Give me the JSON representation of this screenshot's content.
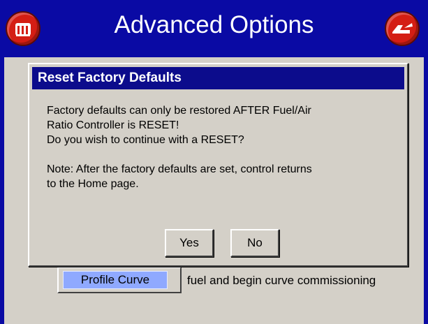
{
  "header": {
    "title": "Advanced Options",
    "left_button_icon": "boiler-icon",
    "right_button_icon": "back-icon",
    "bar_color": "#0a0aa4",
    "button_color": "#d41e14"
  },
  "background": {
    "profile_button_label": "Profile Curve",
    "profile_description": "fuel and begin curve commissioning"
  },
  "dialog": {
    "title": "Reset Factory Defaults",
    "message_line1": "Factory defaults can only be restored AFTER Fuel/Air",
    "message_line2": "Ratio Controller is RESET!",
    "message_line3": "Do you wish to continue with a RESET?",
    "note_line1": "Note: After the factory defaults are set, control returns",
    "note_line2": "to the Home page.",
    "yes_label": "Yes",
    "no_label": "No"
  }
}
